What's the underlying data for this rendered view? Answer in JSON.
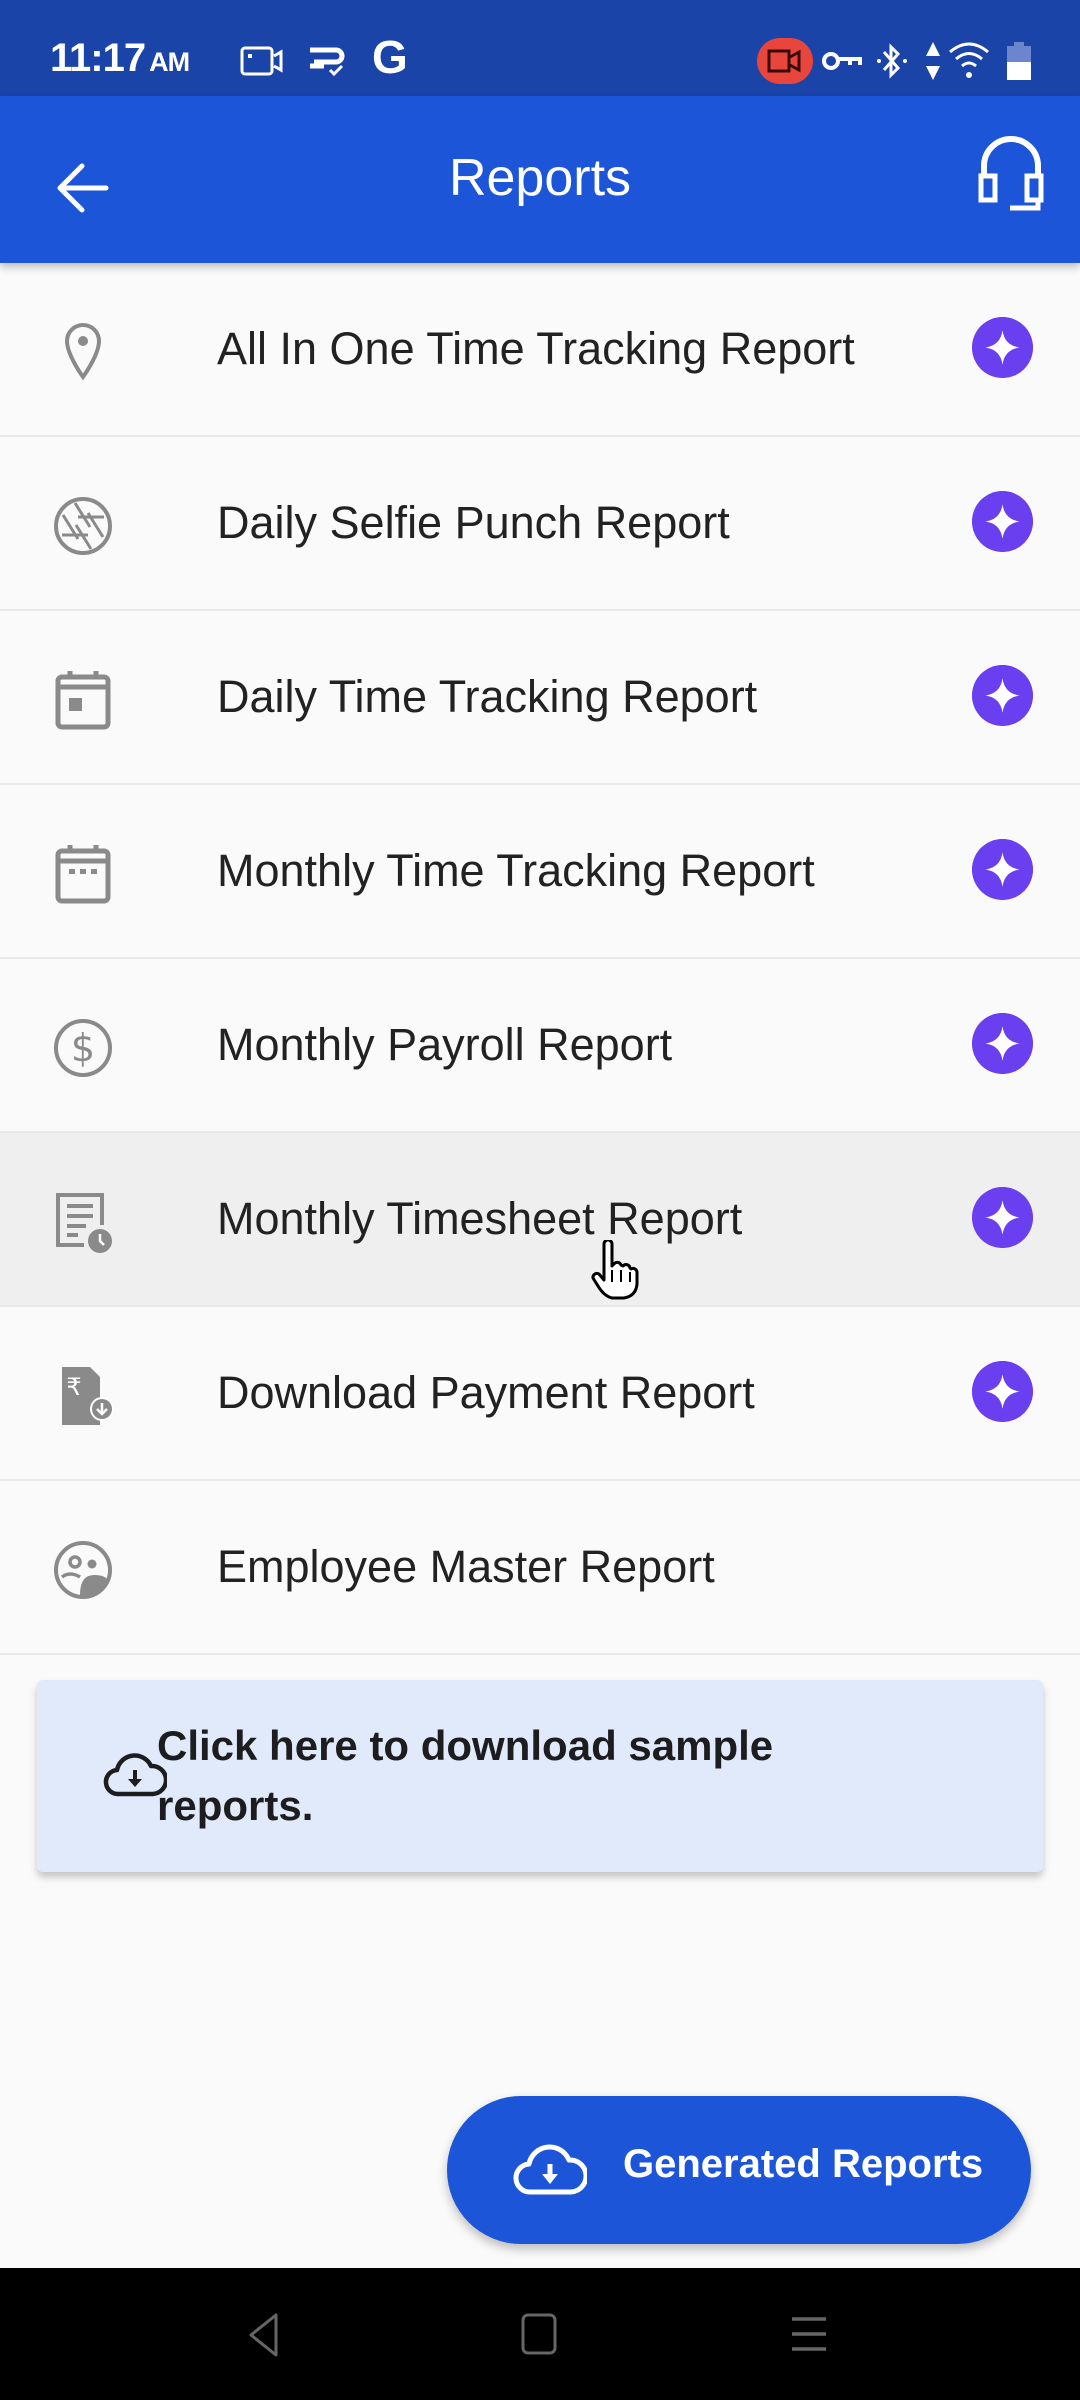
{
  "status_bar": {
    "time": "11:17",
    "ampm": "AM",
    "left_icons": [
      "screen-record-icon",
      "sync-icon",
      "google-icon"
    ],
    "right_icons": [
      "camera-recording-icon",
      "vpn-key-icon",
      "bluetooth-icon",
      "data-arrows-icon",
      "wifi-icon",
      "battery-icon"
    ],
    "google_glyph": "G"
  },
  "app_bar": {
    "title": "Reports",
    "back_icon": "arrow-left-icon",
    "support_icon": "headset-icon"
  },
  "colors": {
    "status_bar": "#1a44a8",
    "app_bar": "#1c55d8",
    "premium_badge": "#6a3ff0",
    "card_bg": "#e1eafa",
    "primary_button": "#1c55d8"
  },
  "reports": [
    {
      "label": "All In One Time Tracking Report",
      "icon": "location-pin-icon",
      "premium": true
    },
    {
      "label": "Daily Selfie Punch Report",
      "icon": "camera-shutter-icon",
      "premium": true
    },
    {
      "label": "Daily Time Tracking Report",
      "icon": "calendar-day-icon",
      "premium": true
    },
    {
      "label": "Monthly Time Tracking Report",
      "icon": "calendar-month-icon",
      "premium": true
    },
    {
      "label": "Monthly Payroll Report",
      "icon": "dollar-circle-icon",
      "premium": true
    },
    {
      "label": "Monthly Timesheet Report",
      "icon": "timesheet-clock-icon",
      "premium": true,
      "highlighted": true
    },
    {
      "label": "Download Payment Report",
      "icon": "rupee-download-icon",
      "premium": true
    },
    {
      "label": "Employee Master Report",
      "icon": "employees-group-icon",
      "premium": false
    }
  ],
  "sample_card": {
    "text": "Click here to download sample reports.",
    "icon": "cloud-download-icon"
  },
  "generated_button": {
    "label": "Generated Reports",
    "icon": "cloud-download-icon"
  },
  "nav_bar": {
    "buttons": [
      "back-nav-icon",
      "home-nav-icon",
      "recents-nav-icon"
    ]
  }
}
